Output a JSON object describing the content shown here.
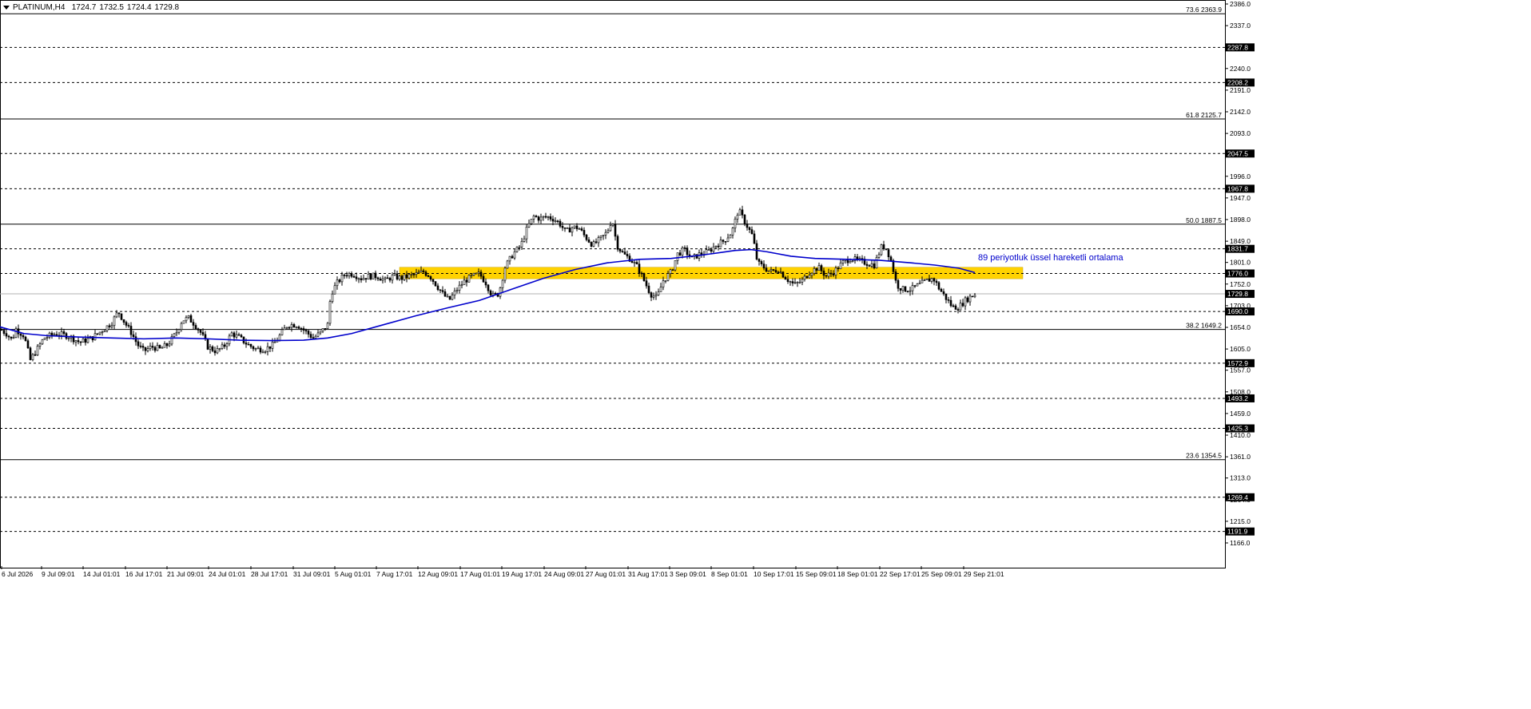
{
  "header": {
    "symbol_tf": "PLATINUM,H4",
    "ohlc": [
      "1724.7",
      "1732.5",
      "1724.4",
      "1729.8"
    ]
  },
  "colors": {
    "background": "#ffffff",
    "candle": "#000000",
    "ema": "#0000cc",
    "zone": "#ffd200",
    "label_bg": "#000000",
    "label_text": "#ffffff",
    "annotation": "#0000cc"
  },
  "chart_data": {
    "type": "candlestick",
    "y_axis": {
      "range": [
        1130,
        2386
      ],
      "ticks": [
        "2386.0",
        "2337.0",
        "2288.0",
        "2240.0",
        "2191.0",
        "2142.0",
        "2093.0",
        "2045.0",
        "1996.0",
        "1947.0",
        "1898.0",
        "1849.0",
        "1801.0",
        "1752.0",
        "1703.0",
        "1654.0",
        "1605.0",
        "1557.0",
        "1508.0",
        "1459.0",
        "1410.0",
        "1361.0",
        "1313.0",
        "1264.0",
        "1215.0",
        "1166.0"
      ]
    },
    "x_axis": {
      "labels": [
        "6 Jul 2026",
        "9 Jul 09:01",
        "14 Jul 01:01",
        "16 Jul 17:01",
        "21 Jul 09:01",
        "24 Jul 01:01",
        "28 Jul 17:01",
        "31 Jul 09:01",
        "5 Aug 01:01",
        "7 Aug 17:01",
        "12 Aug 09:01",
        "17 Aug 01:01",
        "19 Aug 17:01",
        "24 Aug 09:01",
        "27 Aug 01:01",
        "31 Aug 17:01",
        "3 Sep 09:01",
        "8 Sep 01:01",
        "10 Sep 17:01",
        "15 Sep 09:01",
        "18 Sep 01:01",
        "22 Sep 17:01",
        "25 Sep 09:01",
        "29 Sep 21:01"
      ]
    },
    "fib_levels": [
      {
        "label": "73.6 2363.9",
        "value": 2363.9
      },
      {
        "label": "61.8 2125.7",
        "value": 2125.7
      },
      {
        "label": "50.0 1887.5",
        "value": 1887.5
      },
      {
        "label": "38.2 1649.2",
        "value": 1649.2
      },
      {
        "label": "23.6 1354.5",
        "value": 1354.5
      }
    ],
    "hlines": [
      {
        "label": "2287.8",
        "value": 2287.8
      },
      {
        "label": "2208.2",
        "value": 2208.2
      },
      {
        "label": "2047.5",
        "value": 2047.5
      },
      {
        "label": "1967.8",
        "value": 1967.8
      },
      {
        "label": "1831.7",
        "value": 1831.7
      },
      {
        "label": "1776.0",
        "value": 1776.0
      },
      {
        "label": "1690.0",
        "value": 1690.0
      },
      {
        "label": "1572.9",
        "value": 1572.9
      },
      {
        "label": "1493.2",
        "value": 1493.2
      },
      {
        "label": "1425.3",
        "value": 1425.3
      },
      {
        "label": "1269.4",
        "value": 1269.4
      },
      {
        "label": "1191.9",
        "value": 1191.9
      }
    ],
    "current_price": {
      "label": "1729.8",
      "value": 1729.8
    },
    "zone": {
      "low": 1764,
      "high": 1790
    },
    "annotation": "89 periyotluk üssel hareketli ortalama",
    "price_path": [
      [
        0,
        1650
      ],
      [
        8,
        1640
      ],
      [
        15,
        1625
      ],
      [
        20,
        1650
      ],
      [
        30,
        1635
      ],
      [
        38,
        1580
      ],
      [
        45,
        1600
      ],
      [
        55,
        1630
      ],
      [
        70,
        1640
      ],
      [
        85,
        1635
      ],
      [
        100,
        1620
      ],
      [
        115,
        1630
      ],
      [
        130,
        1650
      ],
      [
        140,
        1665
      ],
      [
        148,
        1690
      ],
      [
        156,
        1665
      ],
      [
        165,
        1640
      ],
      [
        172,
        1615
      ],
      [
        180,
        1600
      ],
      [
        190,
        1610
      ],
      [
        200,
        1605
      ],
      [
        210,
        1615
      ],
      [
        220,
        1640
      ],
      [
        228,
        1670
      ],
      [
        236,
        1675
      ],
      [
        244,
        1660
      ],
      [
        252,
        1640
      ],
      [
        260,
        1610
      ],
      [
        270,
        1600
      ],
      [
        280,
        1610
      ],
      [
        290,
        1640
      ],
      [
        300,
        1630
      ],
      [
        310,
        1615
      ],
      [
        320,
        1605
      ],
      [
        332,
        1605
      ],
      [
        342,
        1615
      ],
      [
        352,
        1640
      ],
      [
        360,
        1660
      ],
      [
        372,
        1660
      ],
      [
        382,
        1645
      ],
      [
        392,
        1630
      ],
      [
        400,
        1640
      ],
      [
        410,
        1660
      ],
      [
        414,
        1730
      ],
      [
        422,
        1755
      ],
      [
        432,
        1775
      ],
      [
        442,
        1775
      ],
      [
        452,
        1765
      ],
      [
        462,
        1770
      ],
      [
        472,
        1770
      ],
      [
        482,
        1760
      ],
      [
        492,
        1770
      ],
      [
        502,
        1765
      ],
      [
        512,
        1770
      ],
      [
        522,
        1775
      ],
      [
        530,
        1780
      ],
      [
        538,
        1770
      ],
      [
        546,
        1750
      ],
      [
        554,
        1730
      ],
      [
        562,
        1715
      ],
      [
        572,
        1740
      ],
      [
        582,
        1760
      ],
      [
        592,
        1770
      ],
      [
        600,
        1775
      ],
      [
        608,
        1755
      ],
      [
        616,
        1725
      ],
      [
        624,
        1730
      ],
      [
        632,
        1790
      ],
      [
        642,
        1820
      ],
      [
        652,
        1840
      ],
      [
        660,
        1880
      ],
      [
        668,
        1905
      ],
      [
        676,
        1900
      ],
      [
        684,
        1905
      ],
      [
        692,
        1900
      ],
      [
        700,
        1890
      ],
      [
        708,
        1870
      ],
      [
        716,
        1880
      ],
      [
        724,
        1880
      ],
      [
        732,
        1860
      ],
      [
        742,
        1840
      ],
      [
        752,
        1855
      ],
      [
        760,
        1870
      ],
      [
        766,
        1900
      ],
      [
        772,
        1840
      ],
      [
        780,
        1820
      ],
      [
        788,
        1810
      ],
      [
        798,
        1790
      ],
      [
        806,
        1760
      ],
      [
        814,
        1730
      ],
      [
        822,
        1720
      ],
      [
        830,
        1760
      ],
      [
        840,
        1780
      ],
      [
        848,
        1820
      ],
      [
        856,
        1830
      ],
      [
        866,
        1810
      ],
      [
        876,
        1820
      ],
      [
        886,
        1825
      ],
      [
        896,
        1840
      ],
      [
        906,
        1850
      ],
      [
        916,
        1870
      ],
      [
        924,
        1920
      ],
      [
        930,
        1900
      ],
      [
        936,
        1880
      ],
      [
        942,
        1860
      ],
      [
        948,
        1800
      ],
      [
        956,
        1790
      ],
      [
        964,
        1780
      ],
      [
        974,
        1785
      ],
      [
        984,
        1765
      ],
      [
        994,
        1750
      ],
      [
        1004,
        1760
      ],
      [
        1014,
        1780
      ],
      [
        1024,
        1790
      ],
      [
        1034,
        1770
      ],
      [
        1044,
        1780
      ],
      [
        1054,
        1800
      ],
      [
        1064,
        1810
      ],
      [
        1074,
        1805
      ],
      [
        1084,
        1800
      ],
      [
        1094,
        1795
      ],
      [
        1104,
        1840
      ],
      [
        1110,
        1830
      ],
      [
        1116,
        1800
      ],
      [
        1122,
        1750
      ],
      [
        1130,
        1740
      ],
      [
        1140,
        1740
      ],
      [
        1150,
        1750
      ],
      [
        1160,
        1760
      ],
      [
        1168,
        1765
      ],
      [
        1176,
        1740
      ],
      [
        1184,
        1720
      ],
      [
        1192,
        1700
      ],
      [
        1200,
        1700
      ],
      [
        1208,
        1715
      ],
      [
        1216,
        1725
      ],
      [
        1222,
        1730
      ]
    ],
    "ema_path": [
      [
        0,
        1655
      ],
      [
        30,
        1640
      ],
      [
        60,
        1635
      ],
      [
        100,
        1632
      ],
      [
        140,
        1630
      ],
      [
        180,
        1628
      ],
      [
        220,
        1630
      ],
      [
        260,
        1628
      ],
      [
        300,
        1625
      ],
      [
        340,
        1624
      ],
      [
        380,
        1625
      ],
      [
        410,
        1630
      ],
      [
        440,
        1640
      ],
      [
        480,
        1660
      ],
      [
        520,
        1680
      ],
      [
        560,
        1698
      ],
      [
        600,
        1715
      ],
      [
        640,
        1740
      ],
      [
        680,
        1765
      ],
      [
        720,
        1785
      ],
      [
        760,
        1800
      ],
      [
        800,
        1808
      ],
      [
        840,
        1810
      ],
      [
        880,
        1818
      ],
      [
        920,
        1828
      ],
      [
        940,
        1830
      ],
      [
        960,
        1825
      ],
      [
        990,
        1815
      ],
      [
        1020,
        1810
      ],
      [
        1060,
        1808
      ],
      [
        1100,
        1806
      ],
      [
        1140,
        1800
      ],
      [
        1170,
        1795
      ],
      [
        1200,
        1788
      ],
      [
        1220,
        1778
      ]
    ]
  }
}
